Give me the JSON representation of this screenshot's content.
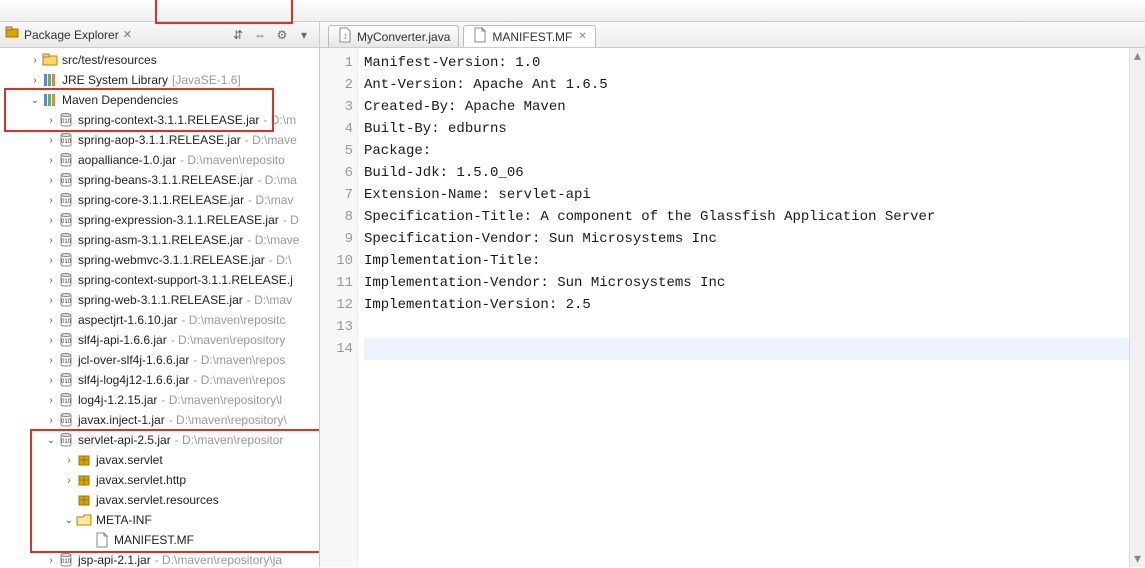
{
  "sidebar": {
    "title": "Package Explorer",
    "items": [
      {
        "twisty": ">",
        "icon": "folder-icon",
        "label": "src/test/resources",
        "path": ""
      },
      {
        "twisty": ">",
        "icon": "library-icon",
        "label": "JRE System Library",
        "path": "[JavaSE-1.6]"
      },
      {
        "twisty": "v",
        "icon": "library-icon",
        "label": "Maven Dependencies",
        "path": ""
      },
      {
        "twisty": ">",
        "indent": 3,
        "icon": "jar-icon",
        "label": "spring-context-3.1.1.RELEASE.jar",
        "path": " - D:\\m"
      },
      {
        "twisty": ">",
        "indent": 3,
        "icon": "jar-icon",
        "label": "spring-aop-3.1.1.RELEASE.jar",
        "path": " - D:\\mave"
      },
      {
        "twisty": ">",
        "indent": 3,
        "icon": "jar-icon",
        "label": "aopalliance-1.0.jar",
        "path": " - D:\\maven\\reposito"
      },
      {
        "twisty": ">",
        "indent": 3,
        "icon": "jar-icon",
        "label": "spring-beans-3.1.1.RELEASE.jar",
        "path": " - D:\\ma"
      },
      {
        "twisty": ">",
        "indent": 3,
        "icon": "jar-icon",
        "label": "spring-core-3.1.1.RELEASE.jar",
        "path": " - D:\\mav"
      },
      {
        "twisty": ">",
        "indent": 3,
        "icon": "jar-icon",
        "label": "spring-expression-3.1.1.RELEASE.jar",
        "path": " - D"
      },
      {
        "twisty": ">",
        "indent": 3,
        "icon": "jar-icon",
        "label": "spring-asm-3.1.1.RELEASE.jar",
        "path": " - D:\\mave"
      },
      {
        "twisty": ">",
        "indent": 3,
        "icon": "jar-icon",
        "label": "spring-webmvc-3.1.1.RELEASE.jar",
        "path": " - D:\\"
      },
      {
        "twisty": ">",
        "indent": 3,
        "icon": "jar-icon",
        "label": "spring-context-support-3.1.1.RELEASE.j",
        "path": ""
      },
      {
        "twisty": ">",
        "indent": 3,
        "icon": "jar-icon",
        "label": "spring-web-3.1.1.RELEASE.jar",
        "path": " - D:\\mav"
      },
      {
        "twisty": ">",
        "indent": 3,
        "icon": "jar-icon",
        "label": "aspectjrt-1.6.10.jar",
        "path": " - D:\\maven\\repositc"
      },
      {
        "twisty": ">",
        "indent": 3,
        "icon": "jar-icon",
        "label": "slf4j-api-1.6.6.jar",
        "path": " - D:\\maven\\repository"
      },
      {
        "twisty": ">",
        "indent": 3,
        "icon": "jar-icon",
        "label": "jcl-over-slf4j-1.6.6.jar",
        "path": " - D:\\maven\\repos"
      },
      {
        "twisty": ">",
        "indent": 3,
        "icon": "jar-icon",
        "label": "slf4j-log4j12-1.6.6.jar",
        "path": " - D:\\maven\\repos"
      },
      {
        "twisty": ">",
        "indent": 3,
        "icon": "jar-icon",
        "label": "log4j-1.2.15.jar",
        "path": " - D:\\maven\\repository\\l"
      },
      {
        "twisty": ">",
        "indent": 3,
        "icon": "jar-icon",
        "label": "javax.inject-1.jar",
        "path": " - D:\\maven\\repository\\"
      },
      {
        "twisty": "v",
        "indent": 3,
        "icon": "jar-icon",
        "label": "servlet-api-2.5.jar",
        "path": " - D:\\maven\\repositor"
      },
      {
        "twisty": ">",
        "indent": 4,
        "icon": "package-icon",
        "label": "javax.servlet",
        "path": ""
      },
      {
        "twisty": ">",
        "indent": 4,
        "icon": "package-icon",
        "label": "javax.servlet.http",
        "path": ""
      },
      {
        "twisty": "",
        "indent": 4,
        "icon": "package-icon",
        "label": "javax.servlet.resources",
        "path": ""
      },
      {
        "twisty": "v",
        "indent": 4,
        "icon": "folder-open-icon",
        "label": "META-INF",
        "path": ""
      },
      {
        "twisty": "",
        "indent": 5,
        "icon": "file-icon",
        "label": "MANIFEST.MF",
        "path": ""
      },
      {
        "twisty": ">",
        "indent": 3,
        "icon": "jar-icon",
        "label": "jsp-api-2.1.jar",
        "path": " - D:\\maven\\repository\\ja"
      }
    ]
  },
  "tabs": [
    {
      "icon": "java-file-icon",
      "label": "MyConverter.java",
      "active": false
    },
    {
      "icon": "file-icon",
      "label": "MANIFEST.MF",
      "active": true
    }
  ],
  "editor": {
    "lines": [
      "Manifest-Version: 1.0",
      "Ant-Version: Apache Ant 1.6.5",
      "Created-By: Apache Maven",
      "Built-By: edburns",
      "Package:",
      "Build-Jdk: 1.5.0_06",
      "Extension-Name: servlet-api",
      "Specification-Title: A component of the Glassfish Application Server",
      "Specification-Vendor: Sun Microsystems Inc",
      "Implementation-Title:",
      "Implementation-Vendor: Sun Microsystems Inc",
      "Implementation-Version: 2.5",
      "",
      ""
    ],
    "cursor_line": 14
  }
}
